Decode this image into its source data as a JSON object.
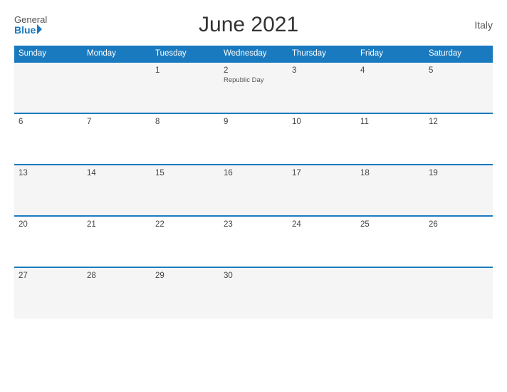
{
  "header": {
    "logo_general": "General",
    "logo_blue": "Blue",
    "title": "June 2021",
    "country": "Italy"
  },
  "weekdays": [
    "Sunday",
    "Monday",
    "Tuesday",
    "Wednesday",
    "Thursday",
    "Friday",
    "Saturday"
  ],
  "weeks": [
    [
      {
        "day": "",
        "event": ""
      },
      {
        "day": "",
        "event": ""
      },
      {
        "day": "1",
        "event": ""
      },
      {
        "day": "2",
        "event": "Republic Day"
      },
      {
        "day": "3",
        "event": ""
      },
      {
        "day": "4",
        "event": ""
      },
      {
        "day": "5",
        "event": ""
      }
    ],
    [
      {
        "day": "6",
        "event": ""
      },
      {
        "day": "7",
        "event": ""
      },
      {
        "day": "8",
        "event": ""
      },
      {
        "day": "9",
        "event": ""
      },
      {
        "day": "10",
        "event": ""
      },
      {
        "day": "11",
        "event": ""
      },
      {
        "day": "12",
        "event": ""
      }
    ],
    [
      {
        "day": "13",
        "event": ""
      },
      {
        "day": "14",
        "event": ""
      },
      {
        "day": "15",
        "event": ""
      },
      {
        "day": "16",
        "event": ""
      },
      {
        "day": "17",
        "event": ""
      },
      {
        "day": "18",
        "event": ""
      },
      {
        "day": "19",
        "event": ""
      }
    ],
    [
      {
        "day": "20",
        "event": ""
      },
      {
        "day": "21",
        "event": ""
      },
      {
        "day": "22",
        "event": ""
      },
      {
        "day": "23",
        "event": ""
      },
      {
        "day": "24",
        "event": ""
      },
      {
        "day": "25",
        "event": ""
      },
      {
        "day": "26",
        "event": ""
      }
    ],
    [
      {
        "day": "27",
        "event": ""
      },
      {
        "day": "28",
        "event": ""
      },
      {
        "day": "29",
        "event": ""
      },
      {
        "day": "30",
        "event": ""
      },
      {
        "day": "",
        "event": ""
      },
      {
        "day": "",
        "event": ""
      },
      {
        "day": "",
        "event": ""
      }
    ]
  ]
}
